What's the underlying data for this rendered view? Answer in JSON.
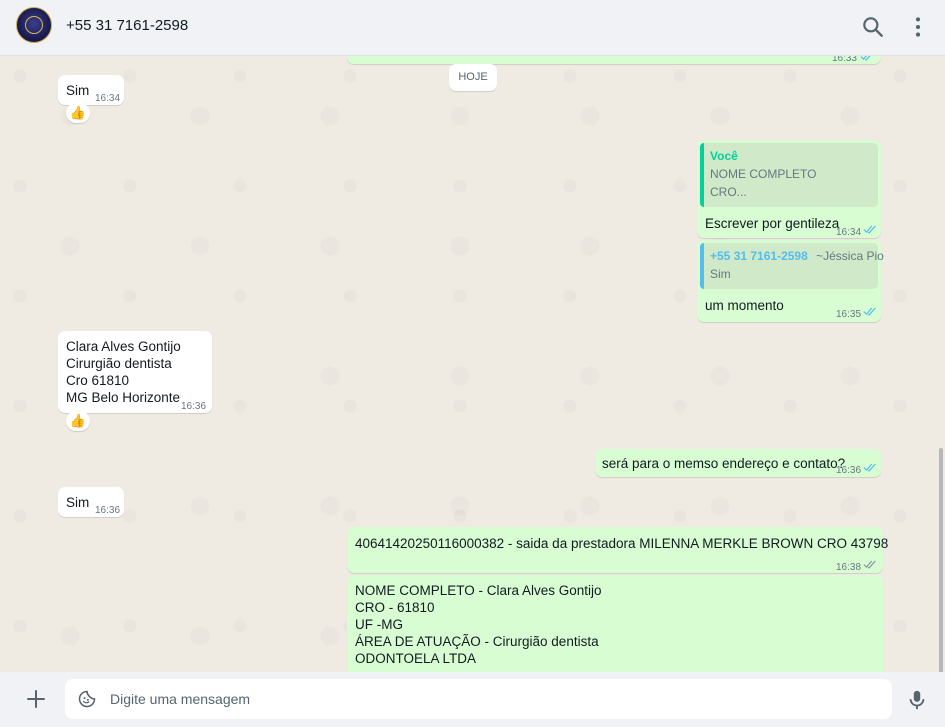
{
  "header": {
    "contact_name": "+55 31 7161-2598",
    "icons": [
      "search-icon",
      "menu-dots-icon"
    ]
  },
  "chat": {
    "date_separator": "HOJE",
    "top_partial_time": "16:33",
    "messages": [
      {
        "id": "m1",
        "direction": "in",
        "text": "Sim",
        "time": "16:34",
        "reaction": "👍"
      },
      {
        "id": "m2",
        "direction": "out",
        "quote_author": "Você",
        "quote_lines": [
          "NOME COMPLETO",
          "CRO..."
        ],
        "text": "Escrever por gentileza",
        "time": "16:34",
        "status": "read"
      },
      {
        "id": "m3",
        "direction": "out",
        "quote_author": "+55 31 7161-2598",
        "quote_pushname": "~Jéssica Pio",
        "quote_lines": [
          "Sim"
        ],
        "text": "um momento",
        "time": "16:35",
        "status": "read"
      },
      {
        "id": "m4",
        "direction": "in",
        "lines": [
          "Clara Alves Gontijo",
          "Cirurgião dentista",
          "Cro 61810",
          "MG Belo Horizonte"
        ],
        "time": "16:36",
        "reaction": "👍"
      },
      {
        "id": "m5",
        "direction": "out",
        "text": "será para o memso endereço e contato?",
        "time": "16:36",
        "status": "read"
      },
      {
        "id": "m6",
        "direction": "in",
        "text": "Sim",
        "time": "16:36"
      },
      {
        "id": "m7",
        "direction": "out",
        "text": "40641420250116000382 - saida da prestadora MILENNA MERKLE BROWN CRO 43798",
        "time": "16:38",
        "status": "sent"
      },
      {
        "id": "m8",
        "direction": "out",
        "lines": [
          "NOME COMPLETO - Clara Alves Gontijo",
          "CRO - 61810",
          "UF -MG",
          "ÁREA DE ATUAÇÃO - Cirurgião dentista",
          "ODONTOELA LTDA"
        ]
      }
    ]
  },
  "composer": {
    "placeholder": "Digite uma mensagem",
    "icons": [
      "plus-icon",
      "sticker-icon",
      "microphone-icon"
    ]
  },
  "colors": {
    "outgoing_bubble": "#d9fdd3",
    "incoming_bubble": "#ffffff",
    "chat_background": "#efeae2",
    "you_quote_accent": "#06cf9c",
    "contact_quote_accent": "#53bdeb",
    "read_check": "#53bdeb"
  }
}
